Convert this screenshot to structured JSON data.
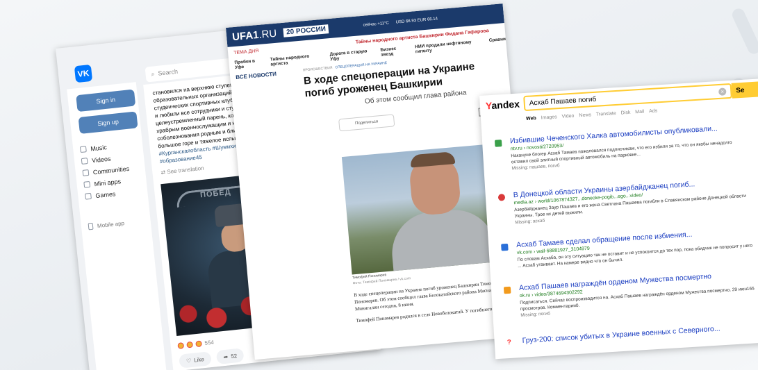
{
  "vk": {
    "logo": "VK",
    "search_placeholder": "Search",
    "sign_in": "Sign in",
    "sign_up": "Sign up",
    "menu": [
      "Music",
      "Videos",
      "Communities",
      "Mini apps",
      "Games"
    ],
    "mobile_app": "Mobile app",
    "post_text": "становился на верхнюю ступень рейтинга профессиональных образовательных организаций областной спартакиады среди студенческих спортивных клубов «Надежды Зауралья – 2021». Его знали и любили все сотрудники и студенты. Добрый, отзывчивый, целеустремленный парень, который вырос достойным мужчиной, храбрым военнослужащим и настоящим героем. Выражаем искренние соболезнования родным и близким. Смерть родного человека - это большое горе и тяжелое испытание.",
    "post_tags": "#Курганскаяобласть #Шумихинскийрайон #Шумиха #ПРО45 #ШАСК #образование45",
    "see_translation": "See translation",
    "image_arch_text": "ПОБЕД",
    "reactions_count": "554",
    "like_label": "Like",
    "share_count": "52"
  },
  "ufa": {
    "logo_main": "UFA1",
    "logo_suffix": ".RU",
    "badge": "20 РОССИИ",
    "weather": "сейчас +11°C",
    "rates": "USD 66.93 EUR 66.14",
    "tema": "ТЕМА ДНЯ",
    "promo": "Тайны народного артиста Башкирии Фидана Гафарова",
    "nav": [
      "Пробки в Уфе",
      "Тайны народного артиста",
      "Дорога в старую Уфу",
      "Бизнес звезд",
      "НИИ продали нефтяному гиганту",
      "Сравни"
    ],
    "all_news": "ВСЕ НОВОСТИ",
    "crumb1": "ПРОИСШЕСТВИЯ",
    "crumb2": "СПЕЦОПЕРАЦИЯ НА УКРАИНЕ",
    "title": "В ходе спецоперации на Украине погиб уроженец Башкирии",
    "subtitle": "Об этом сообщил глава района",
    "share": "Поделиться",
    "photo_caption": "Тимофей Пономарев",
    "photo_credit": "Фото: Тимофей Пономарев / vk.com",
    "body": "В ходе спецоперации на Украине погиб уроженец Башкирии Тимофей Пономарев. Об этом сообщил глава Белокатайского района Маснави Минигалин сегодня, 8 июня.",
    "body2": "Тимофей Пономарев родился в селе Новобелокатай. У погибшего жена"
  },
  "yandex": {
    "logo": "Yandex",
    "query": "Асхаб Пашаев погиб",
    "go": "Se",
    "tabs": [
      "Web",
      "Images",
      "Video",
      "News",
      "Translate",
      "Disk",
      "Mail",
      "Ads"
    ],
    "results": [
      {
        "title": "Избившие Чеченского Халка автомобилисты опубликовали...",
        "url": "ntv.ru › novosti/2720953/",
        "desc": "Накануне блогер Асхаб Тамаев пожаловался подписчикам, что его избили за то, что он якобы ненадолго оставил свой элитный спортивный автомобиль на парковке...",
        "missing": "Missing: пашаев, погиб",
        "fav_color": "#3aa04a"
      },
      {
        "title": "В Донецкой области Украины азербайджанец погиб...",
        "url": "media.az › world/1067874327...donecke-pogib...ego...video/",
        "desc": "Азербайджанец Заур Пашаев и его жена Светлана Пашаева погибли в Славянском районе Донецкой области Украины. Трое их детей выжили.",
        "missing": "Missing: асхаб",
        "fav_color": "#d93a3a"
      },
      {
        "title": "Асхаб Тамаев сделал обращение после избиения...",
        "url": "vk.com › wall-68881927_3104979",
        "desc": "По словам Асхаба, он эту ситуацию так не оставит и не успокоится до тех пор, пока обидчик не попросит у него ... Асхаб утаивает. На камере видно что он бычил.",
        "missing": "",
        "fav_color": "#2a6fd8"
      },
      {
        "title": "Асхаб Пашаев награждён орденом Мужества посмертно",
        "url": "ok.ru › video/3874694302292",
        "desc": "Подписаться. Сейчас воспроизводится на. Асхаб Пашаев награждён орденом Мужества посмертно. 29 июн165 просмотров. Комментарии0.",
        "missing": "Missing: погиб",
        "fav_color": "#f29a1d"
      }
    ],
    "last_title": "Груз-200: список убитых в Украине военных с Северного..."
  }
}
